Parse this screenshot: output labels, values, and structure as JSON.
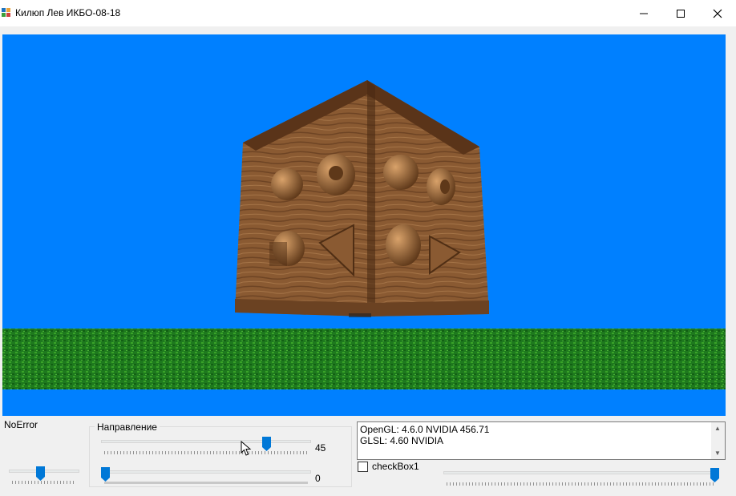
{
  "window": {
    "title": "Килюп Лев ИКБО-08-18",
    "icons": {
      "app": "app-icon",
      "minimize": "minimize-icon",
      "maximize": "maximize-icon",
      "close": "close-icon"
    }
  },
  "viewport": {
    "sky_color": "#0080ff",
    "ground_color": "#1f8a1f",
    "cube_color": "#8b5a32",
    "content": "wooden cube with spheres, tori and cones"
  },
  "status": {
    "label": "NoError"
  },
  "direction_group": {
    "title": "Направление",
    "slider1_value": "45",
    "slider2_value": "0",
    "slider1_position": 0.79,
    "slider2_position": 0.0
  },
  "left_slider": {
    "position": 0.45
  },
  "right_slider": {
    "position": 1.0
  },
  "info": {
    "line1": "OpenGL: 4.6.0 NVIDIA 456.71",
    "line2": "GLSL: 4.60 NVIDIA"
  },
  "checkbox": {
    "label": "checkBox1",
    "checked": false
  },
  "accent_color": "#0078d7"
}
